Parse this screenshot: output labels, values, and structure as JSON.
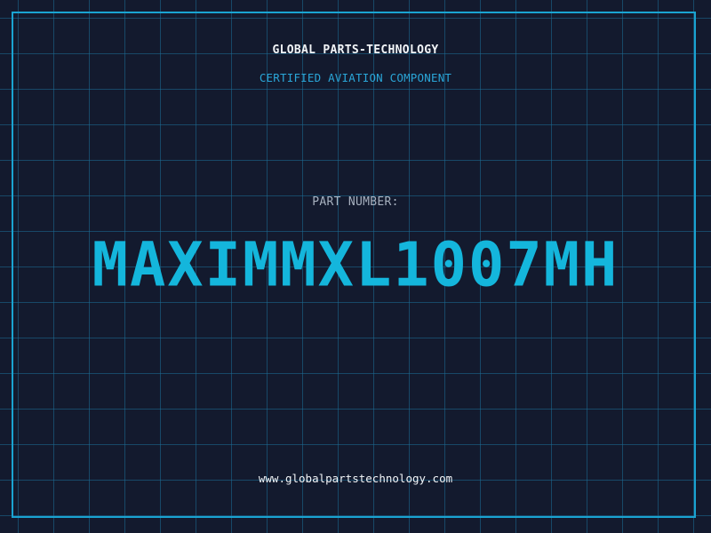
{
  "header": {
    "company": "GLOBAL PARTS-TECHNOLOGY",
    "tagline": "CERTIFIED AVIATION COMPONENT"
  },
  "part": {
    "label": "PART NUMBER:",
    "number": "MAXIMMXL1007MH"
  },
  "footer": {
    "url": "www.globalpartstechnology.com"
  },
  "colors": {
    "background": "#131a2e",
    "grid": "#1c6e96",
    "accent": "#14b6dc",
    "frame": "#1aa3d1"
  }
}
